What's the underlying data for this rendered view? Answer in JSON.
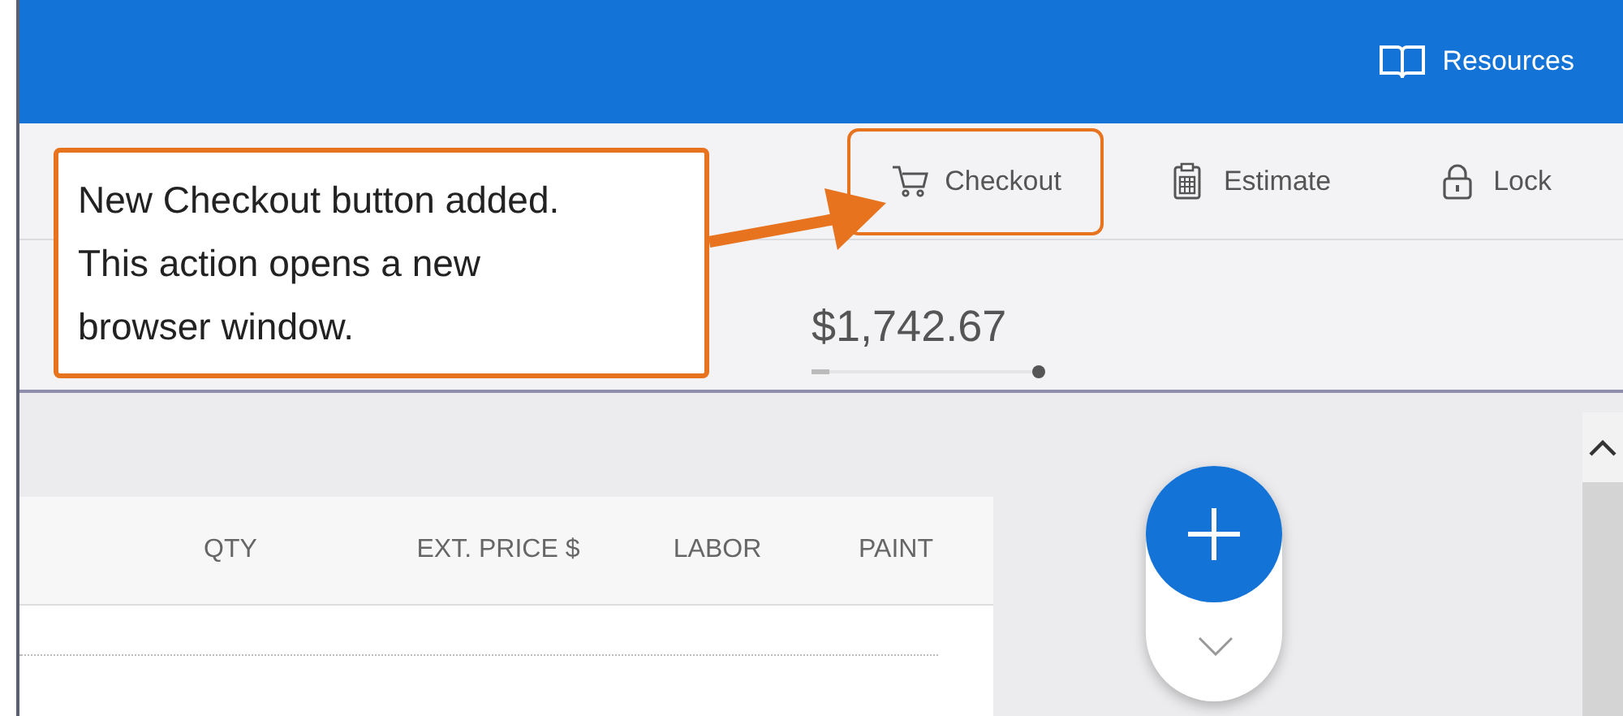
{
  "header": {
    "resources": "Resources"
  },
  "toolbar": [
    {
      "kind": "cart",
      "label": "Checkout",
      "highlighted": true
    },
    {
      "kind": "clipboard",
      "label": "Estimate",
      "highlighted": false
    },
    {
      "kind": "lock",
      "label": "Lock",
      "highlighted": false
    }
  ],
  "total": "$1,742.67",
  "table": {
    "columns": [
      "QTY",
      "EXT. PRICE $",
      "LABOR",
      "PAINT"
    ]
  },
  "callout": {
    "text": "New Checkout button added. This action opens a new browser window."
  }
}
